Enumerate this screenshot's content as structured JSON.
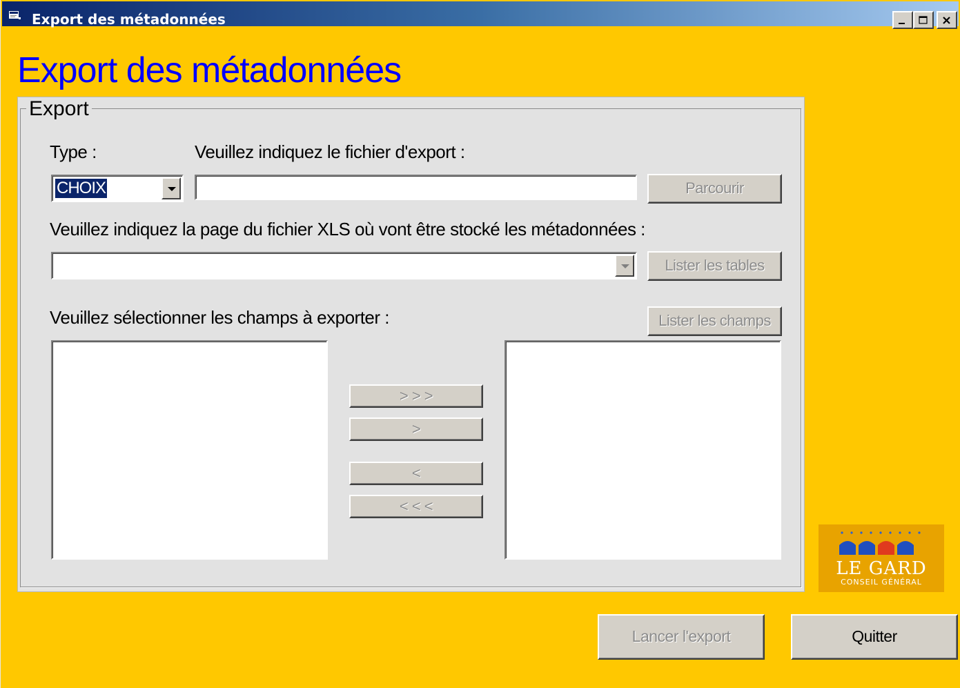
{
  "window": {
    "title": "Export des métadonnées",
    "icon": "app-icon",
    "controls": [
      "minimize-icon",
      "maximize-icon",
      "close-icon"
    ]
  },
  "page": {
    "title": "Export des métadonnées"
  },
  "export_group": {
    "legend": "Export",
    "type_label": "Type :",
    "type_value": "CHOIX",
    "file_label": "Veuillez indiquez le fichier d'export :",
    "file_value": "",
    "browse_button": "Parcourir",
    "sheet_label": "Veuillez indiquez la page du fichier XLS où vont être stocké les métadonnées :",
    "sheet_value": "",
    "list_tables_button": "Lister les tables",
    "fields_label": "Veuillez sélectionner les champs à exporter :",
    "list_fields_button": "Lister les champs",
    "available_fields": [],
    "selected_fields": [],
    "move_all_right": "> > >",
    "move_right": ">",
    "move_left": "<",
    "move_all_left": "< < <"
  },
  "footer": {
    "launch_button": "Lancer l'export",
    "quit_button": "Quitter"
  },
  "logo": {
    "name": "LE GARD",
    "subtitle": "CONSEIL GÉNÉRAL"
  },
  "colors": {
    "background": "#FFC800",
    "title": "#0000FF",
    "panel": "#E2E2E2",
    "titlebar_start": "#0A246A",
    "titlebar_end": "#A6CAF0"
  }
}
